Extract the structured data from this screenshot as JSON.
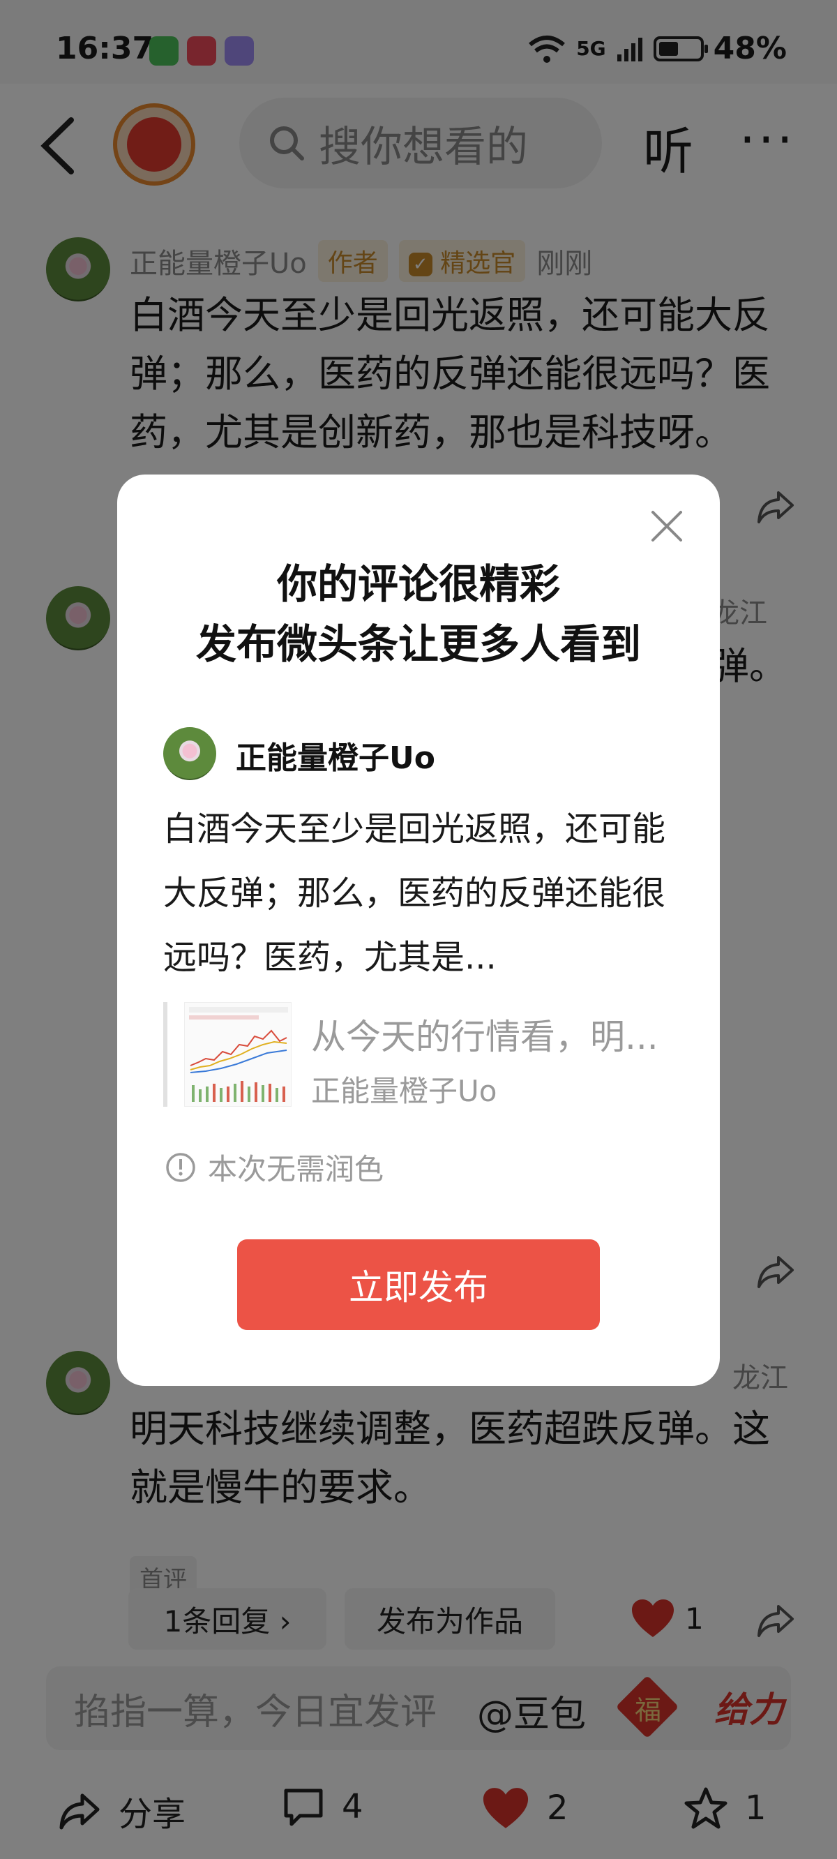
{
  "status_bar": {
    "time": "16:37",
    "network": "5G",
    "battery": "48%",
    "battery_level": 0.48
  },
  "header": {
    "search_placeholder": "搜你想看的",
    "listen_label": "听",
    "more_label": "···"
  },
  "comments": [
    {
      "name": "正能量橙子Uo",
      "author_tag": "作者",
      "select_tag": "精选官",
      "time": "刚刚",
      "text": "白酒今天至少是回光返照，还可能大反弹；那么，医药的反弹还能很远吗？医药，尤其是创新药，那也是科技呀。"
    },
    {
      "partial_location": "龙江",
      "partial_text": "弹。"
    },
    {
      "partial_location": "龙江",
      "text": "明天科技继续调整，医药超跌反弹。这就是慢牛的要求。",
      "first_tag": "首评",
      "replies_label": "1条回复 ›",
      "publish_as_work_label": "发布为作品",
      "like_count": "1"
    }
  ],
  "comment_input": {
    "placeholder": "掐指一算，今日宜发评",
    "doubao": "@豆包",
    "fu": "福",
    "geili": "给力"
  },
  "bottom_bar": {
    "share": "分享",
    "comments": "4",
    "likes": "2",
    "favorites": "1"
  },
  "modal": {
    "title_line1": "你的评论很精彩",
    "title_line2": "发布微头条让更多人看到",
    "author": "正能量橙子Uo",
    "text": "白酒今天至少是回光返照，还可能大反弹；那么，医药的反弹还能很远吗？医药，尤其是...",
    "quote_title": "从今天的行情看，明...",
    "quote_author": "正能量橙子Uo",
    "note": "本次无需润色",
    "publish_button": "立即发布"
  },
  "colors": {
    "accent": "#ec5346",
    "tag_gold": "#c98a2a",
    "heart": "#d8332a"
  }
}
